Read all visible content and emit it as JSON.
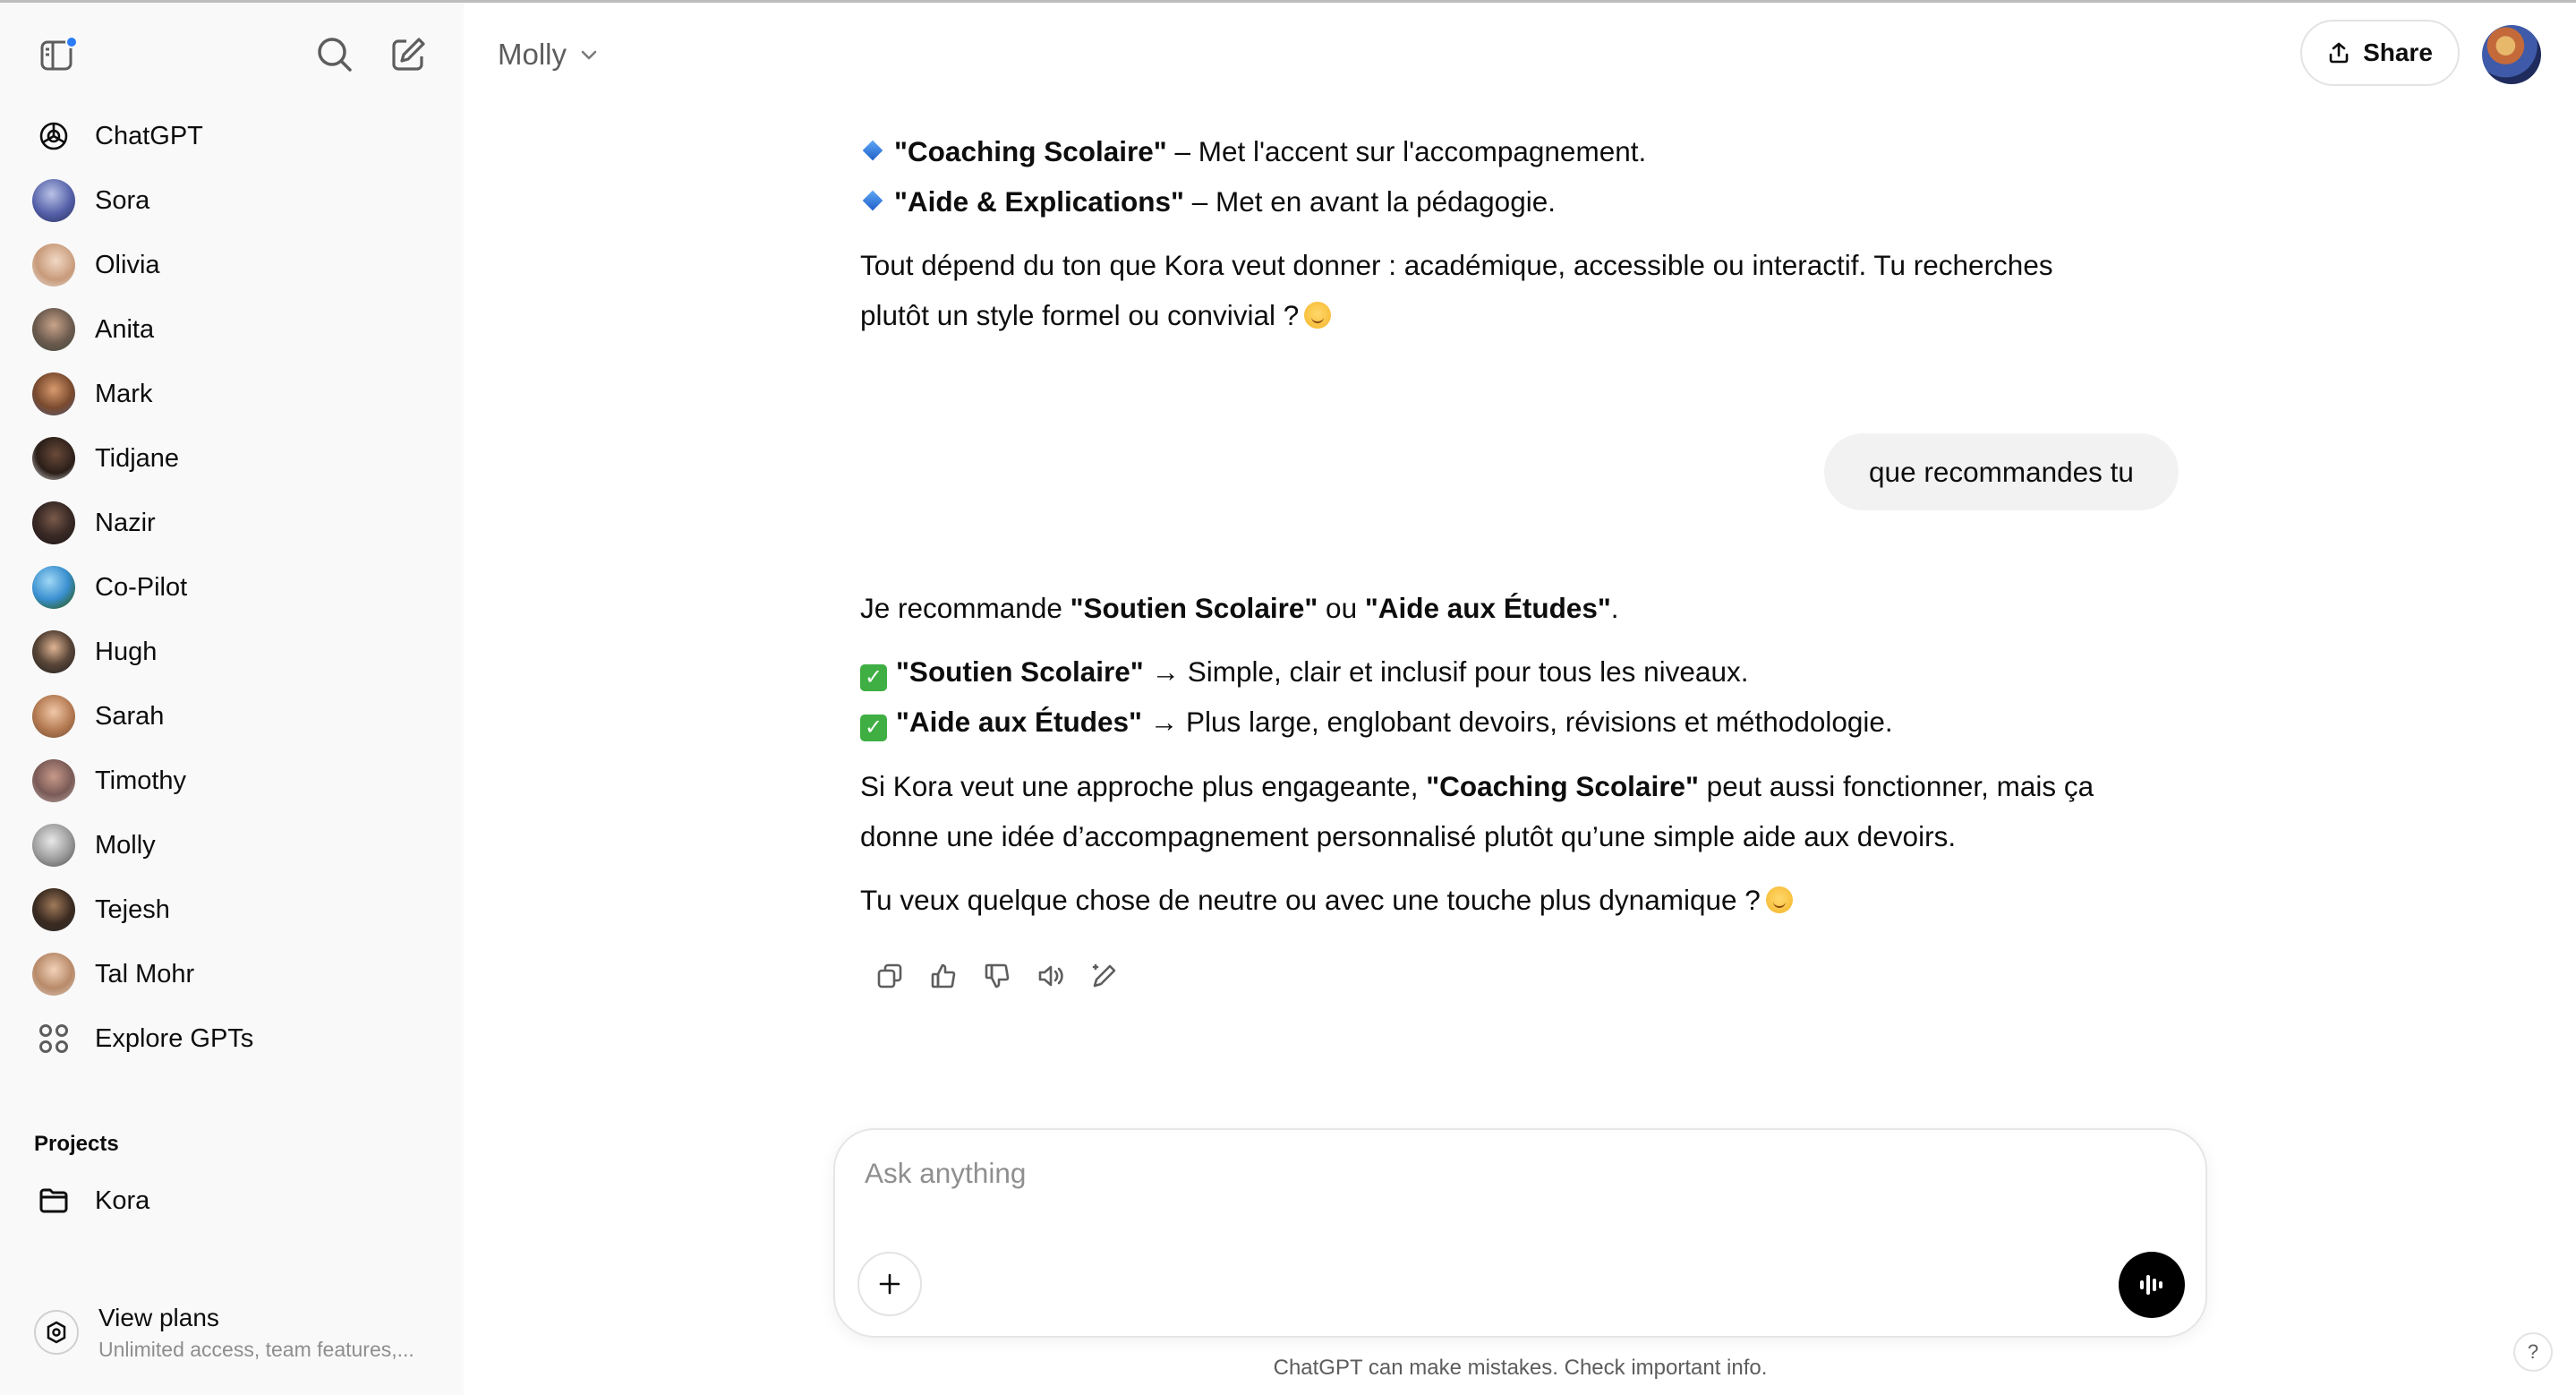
{
  "sidebar": {
    "items": [
      {
        "label": "ChatGPT",
        "icon": "openai-logo-icon"
      },
      {
        "label": "Sora",
        "icon": "sora-avatar"
      },
      {
        "label": "Olivia",
        "icon": "olivia-avatar"
      },
      {
        "label": "Anita",
        "icon": "anita-avatar"
      },
      {
        "label": "Mark",
        "icon": "mark-avatar"
      },
      {
        "label": "Tidjane",
        "icon": "tidjane-avatar"
      },
      {
        "label": "Nazir",
        "icon": "nazir-avatar"
      },
      {
        "label": "Co-Pilot",
        "icon": "globe-avatar"
      },
      {
        "label": "Hugh",
        "icon": "hugh-avatar"
      },
      {
        "label": "Sarah",
        "icon": "sarah-avatar"
      },
      {
        "label": "Timothy",
        "icon": "timothy-avatar"
      },
      {
        "label": "Molly",
        "icon": "molly-avatar"
      },
      {
        "label": "Tejesh",
        "icon": "tejesh-avatar"
      },
      {
        "label": "Tal Mohr",
        "icon": "tal-mohr-avatar"
      },
      {
        "label": "Explore GPTs",
        "icon": "grid-icon"
      }
    ],
    "projects_heading": "Projects",
    "projects": [
      {
        "label": "Kora",
        "icon": "folder-icon"
      }
    ],
    "plans": {
      "title": "View plans",
      "subtitle": "Unlimited access, team features,..."
    }
  },
  "header": {
    "model_label": "Molly",
    "share_label": "Share"
  },
  "chat": {
    "assistant_1": {
      "bullet_1_bold": "\"Coaching Scolaire\"",
      "bullet_1_text": " – Met l'accent sur l'accompagnement.",
      "bullet_2_bold": "\"Aide & Explications\"",
      "bullet_2_text": " – Met en avant la pédagogie.",
      "para_line_1": "Tout dépend du ton que Kora veut donner : académique, accessible ou interactif. Tu recherches",
      "para_line_2": "plutôt un style formel ou convivial ?"
    },
    "user_message": "que recommandes tu",
    "assistant_2": {
      "intro_pre": "Je recommande ",
      "intro_bold_1": "\"Soutien Scolaire\"",
      "intro_mid": " ou ",
      "intro_bold_2": "\"Aide aux Études\"",
      "intro_end": ".",
      "check_1_bold": "\"Soutien Scolaire\"",
      "check_1_text": " → Simple, clair et inclusif pour tous les niveaux.",
      "check_2_bold": "\"Aide aux Études\"",
      "check_2_text": " → Plus large, englobant devoirs, révisions et méthodologie.",
      "para_pre": "Si Kora veut une approche plus engageante, ",
      "para_bold": "\"Coaching Scolaire\"",
      "para_post": " peut aussi fonctionner, mais ça",
      "para_line_2": "donne une idée d’accompagnement personnalisé plutôt qu’une simple aide aux devoirs.",
      "closing": "Tu veux quelque chose de neutre ou avec une touche plus dynamique ?"
    },
    "action_icons": [
      "copy-icon",
      "thumbs-up-icon",
      "thumbs-down-icon",
      "read-aloud-icon",
      "edit-icon"
    ]
  },
  "composer": {
    "placeholder": "Ask anything",
    "disclaimer": "ChatGPT can make mistakes. Check important info.",
    "help_label": "?"
  }
}
